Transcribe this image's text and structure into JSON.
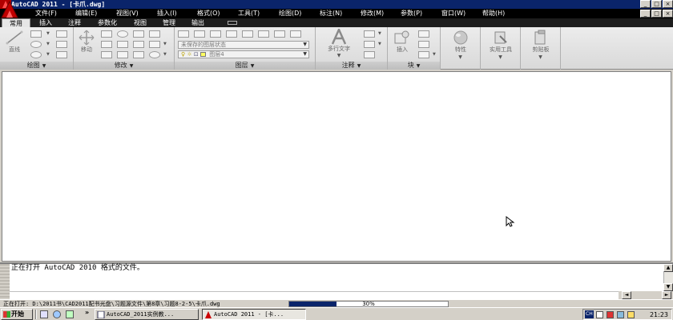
{
  "window": {
    "title": "AutoCAD 2011 - [卡爪.dwg]"
  },
  "menubar": {
    "items": [
      "文件(F)",
      "编辑(E)",
      "视图(V)",
      "插入(I)",
      "格式(O)",
      "工具(T)",
      "绘图(D)",
      "标注(N)",
      "修改(M)",
      "参数(P)",
      "窗口(W)",
      "帮助(H)"
    ]
  },
  "ribbon": {
    "tabs": [
      "常用",
      "插入",
      "注释",
      "参数化",
      "视图",
      "管理",
      "输出"
    ],
    "active_tab": "常用",
    "panels": {
      "draw": {
        "label": "绘图",
        "line_tool": "直线"
      },
      "modify": {
        "label": "修改",
        "move_tool": "移动"
      },
      "layers": {
        "label": "图层",
        "layer_state": "未保存的图层状态",
        "current_layer": "图层4"
      },
      "annotation": {
        "label": "注释",
        "mtext_tool": "多行文字"
      },
      "block": {
        "label": "块",
        "insert_tool": "插入"
      },
      "properties": {
        "label": "特性"
      },
      "utilities": {
        "label": "实用工具"
      },
      "clipboard": {
        "label": "剪贴板"
      }
    }
  },
  "command_line": {
    "history": "正在打开 AutoCAD 2010 格式的文件。"
  },
  "status": {
    "text": "正在打开: D:\\2011书\\CAD2011配书光盘\\习题源文件\\第8章\\习题8-2-5\\卡爪.dwg",
    "progress_label": "30%",
    "progress_value": 0.3
  },
  "taskbar": {
    "start_label": "开始",
    "tasks": [
      "AutoCAD_2011实例教...",
      "AutoCAD 2011 - [卡..."
    ],
    "clock": "21:23",
    "ime_label": "CH"
  },
  "colors": {
    "titlebar": "#0a246a",
    "menubar": "#000000",
    "ribbon_tabs": "#1d1d1d",
    "progress_fill": "#0a246a",
    "layer_color": "#ffff60"
  },
  "icons": {
    "app": "autocad-logo-icon",
    "cursor": "mouse-pointer-icon"
  }
}
